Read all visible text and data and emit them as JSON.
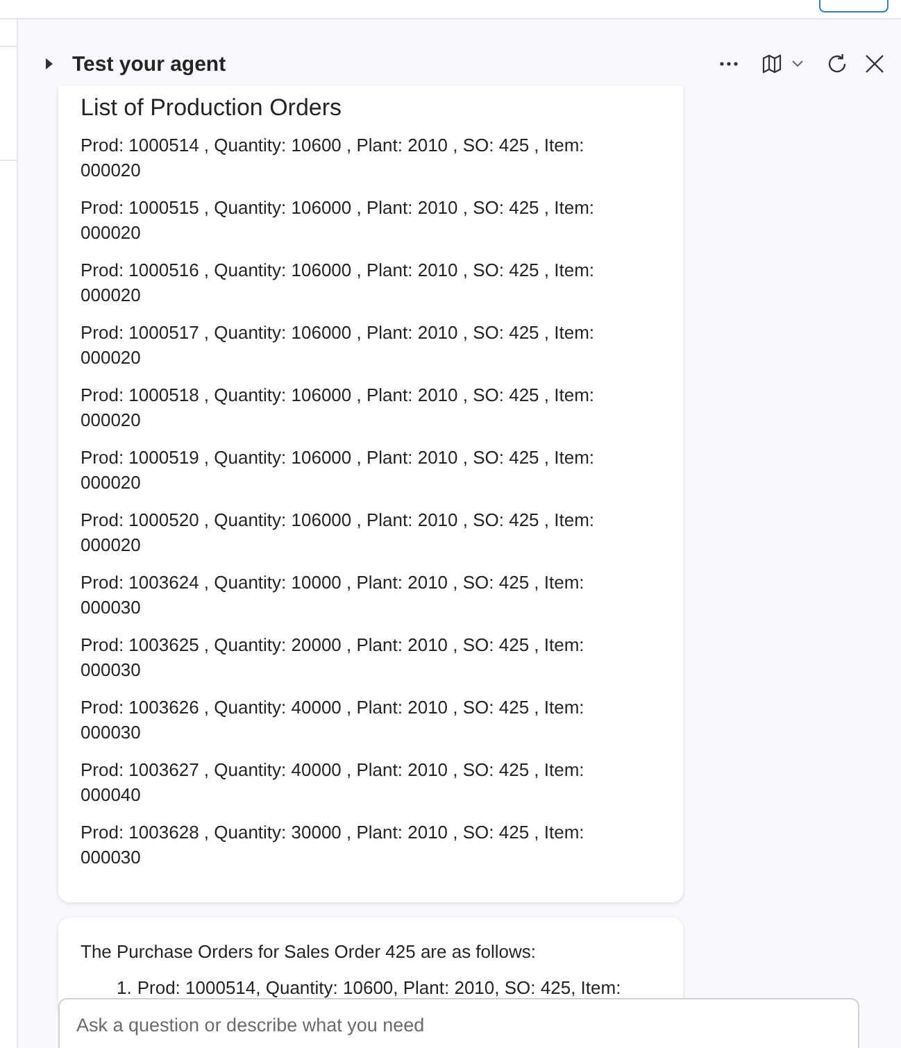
{
  "panel": {
    "title": "Test your agent"
  },
  "production_card": {
    "title": "List of Production Orders",
    "orders": [
      {
        "text": "Prod: 1000514 , Quantity: 10600 , Plant: 2010 , SO: 425 , Item: 000020"
      },
      {
        "text": "Prod: 1000515 , Quantity: 106000 , Plant: 2010 , SO: 425 , Item: 000020"
      },
      {
        "text": "Prod: 1000516 , Quantity: 106000 , Plant: 2010 , SO: 425 , Item: 000020"
      },
      {
        "text": "Prod: 1000517 , Quantity: 106000 , Plant: 2010 , SO: 425 , Item: 000020"
      },
      {
        "text": "Prod: 1000518 , Quantity: 106000 , Plant: 2010 , SO: 425 , Item: 000020"
      },
      {
        "text": "Prod: 1000519 , Quantity: 106000 , Plant: 2010 , SO: 425 , Item: 000020"
      },
      {
        "text": "Prod: 1000520 , Quantity: 106000 , Plant: 2010 , SO: 425 , Item: 000020"
      },
      {
        "text": "Prod: 1003624 , Quantity: 10000 , Plant: 2010 , SO: 425 , Item: 000030"
      },
      {
        "text": "Prod: 1003625 , Quantity: 20000 , Plant: 2010 , SO: 425 , Item: 000030"
      },
      {
        "text": "Prod: 1003626 , Quantity: 40000 , Plant: 2010 , SO: 425 , Item: 000030"
      },
      {
        "text": "Prod: 1003627 , Quantity: 40000 , Plant: 2010 , SO: 425 , Item: 000040"
      },
      {
        "text": "Prod: 1003628 , Quantity: 30000 , Plant: 2010 , SO: 425 , Item: 000030"
      }
    ]
  },
  "reply_card": {
    "intro": "The Purchase Orders for Sales Order 425 are as follows:",
    "items": [
      {
        "number": "1.",
        "text": "Prod: 1000514, Quantity: 10600, Plant: 2010, SO: 425, Item:"
      }
    ]
  },
  "input": {
    "placeholder": "Ask a question or describe what you need"
  }
}
